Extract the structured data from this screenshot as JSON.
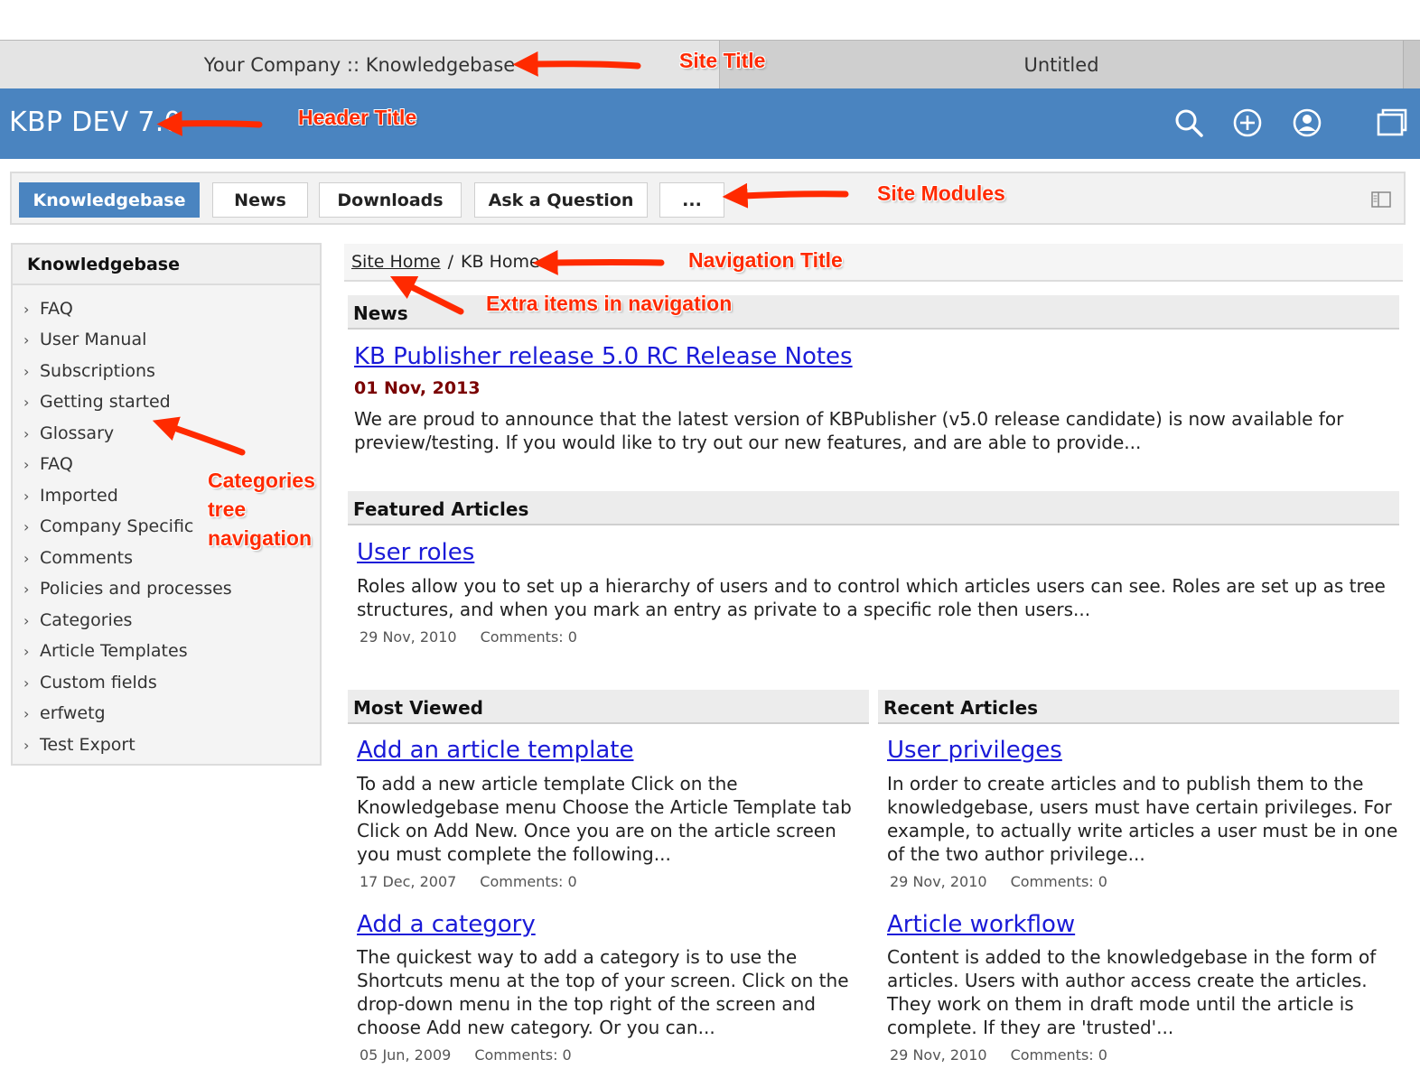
{
  "browser": {
    "active_tab": "Your Company :: Knowledgebase",
    "inactive_tab": "Untitled"
  },
  "header": {
    "title": "KBP DEV 7.0",
    "icons": [
      "search-icon",
      "add-icon",
      "user-icon",
      "window-icon"
    ],
    "background": "#4a84c0"
  },
  "modules": {
    "items": [
      "Knowledgebase",
      "News",
      "Downloads",
      "Ask a Question",
      "..."
    ],
    "active": "Knowledgebase"
  },
  "sidebar": {
    "title": "Knowledgebase",
    "items": [
      "FAQ",
      "User Manual",
      "Subscriptions",
      "Getting started",
      "Glossary",
      "FAQ",
      "Imported",
      "Company Specific",
      "Comments",
      "Policies and processes",
      "Categories",
      "Article Templates",
      "Custom fields",
      "erfwetg",
      "Test Export"
    ]
  },
  "breadcrumb": {
    "home": "Site Home",
    "separator": "/",
    "current": "KB Home"
  },
  "news": {
    "heading": "News",
    "title": "KB Publisher release 5.0 RC Release Notes",
    "date": "01 Nov, 2013",
    "excerpt": "We are proud to announce that the latest version of KBPublisher (v5.0 release candidate) is now available for preview/testing. If you would like to try out our new features, and are able to provide..."
  },
  "featured": {
    "heading": "Featured Articles",
    "title": "User roles",
    "excerpt": "Roles allow you to set up a hierarchy of users and to control which articles users can see. Roles are set up as tree structures, and when you mark an entry as private to a specific role then users...",
    "date": "29 Nov, 2010",
    "comments": "Comments: 0"
  },
  "most_viewed": {
    "heading": "Most Viewed",
    "articles": [
      {
        "title": "Add an article template",
        "excerpt": "To add a new article template Click on the Knowledgebase menu Choose the Article Template tab Click on Add New. Once you are on the article screen you must complete the following...",
        "date": "17 Dec, 2007",
        "comments": "Comments: 0"
      },
      {
        "title": "Add a category",
        "excerpt": "The quickest way to add a category is to use the Shortcuts menu at the top of your screen. Click on the drop-down menu in the top right of the screen and choose Add new category. Or you can...",
        "date": "05 Jun, 2009",
        "comments": "Comments: 0"
      }
    ]
  },
  "recent": {
    "heading": "Recent Articles",
    "articles": [
      {
        "title": "User privileges",
        "excerpt": "In order to create articles and to publish them to the knowledgebase, users must have certain privileges. For example, to actually write articles a user must be in one of the two author privilege...",
        "date": "29 Nov, 2010",
        "comments": "Comments: 0"
      },
      {
        "title": "Article workflow",
        "excerpt": "Content is added to the knowledgebase in the form of articles. Users with author access create the articles. They work on them in draft mode until the article is complete. If they are 'trusted'...",
        "date": "29 Nov, 2010",
        "comments": "Comments: 0"
      }
    ]
  },
  "annotations": {
    "site_title": "Site Title",
    "header_title": "Header Title",
    "site_modules": "Site Modules",
    "navigation_title": "Navigation Title",
    "extra_items": "Extra items in navigation",
    "categories_line1": "Categories",
    "categories_line2": "tree",
    "categories_line3": "navigation",
    "color": "#ff2a00"
  }
}
